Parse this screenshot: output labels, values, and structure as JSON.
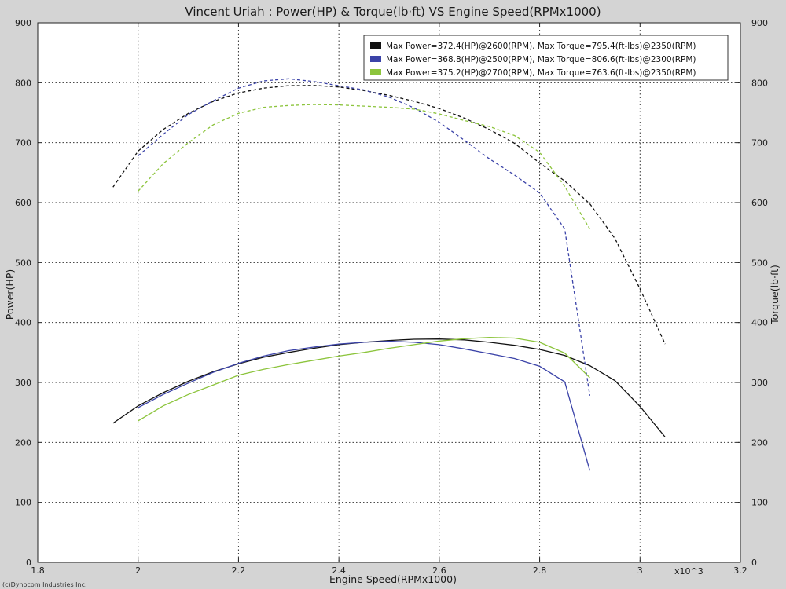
{
  "chart_data": {
    "type": "line",
    "title": "Vincent Uriah : Power(HP) & Torque(lb·ft) VS Engine Speed(RPMx1000)",
    "xlabel": "Engine Speed(RPMx1000)",
    "ylabel": "Power(HP)",
    "y2label": "Torque(lb·ft)",
    "x_multiplier": "x10^3",
    "copyright": "(c)Dynocom Industries Inc.",
    "xlim": [
      1.8,
      3.2
    ],
    "ylim": [
      0,
      900
    ],
    "y2lim": [
      0,
      900
    ],
    "x_ticks": [
      1.8,
      2,
      2.2,
      2.4,
      2.6,
      2.8,
      3,
      3.2
    ],
    "x_tick_labels": [
      "1.8",
      "2",
      "2.2",
      "2.4",
      "2.6",
      "2.8",
      "3",
      "3.2"
    ],
    "y_ticks": [
      0,
      100,
      200,
      300,
      400,
      500,
      600,
      700,
      800,
      900
    ],
    "y_tick_labels": [
      "0",
      "100",
      "200",
      "300",
      "400",
      "500",
      "600",
      "700",
      "800",
      "900"
    ],
    "grid": true,
    "legend_position": "top-right",
    "legend": [
      "Max Power=372.4(HP)@2600(RPM), Max Torque=795.4(ft-lbs)@2350(RPM)",
      "Max Power=368.8(HP)@2500(RPM), Max Torque=806.6(ft-lbs)@2300(RPM)",
      "Max Power=375.2(HP)@2700(RPM), Max Torque=763.6(ft-lbs)@2350(RPM)"
    ],
    "series": [
      {
        "color": "#111111",
        "power": {
          "x": [
            1.95,
            2.0,
            2.05,
            2.1,
            2.15,
            2.2,
            2.25,
            2.3,
            2.35,
            2.4,
            2.45,
            2.5,
            2.55,
            2.6,
            2.65,
            2.7,
            2.75,
            2.8,
            2.85,
            2.9,
            2.95,
            3.0,
            3.05
          ],
          "y": [
            232,
            261,
            283,
            302,
            318,
            331,
            342,
            350,
            357,
            363,
            367,
            370,
            372,
            372.4,
            371,
            367,
            362,
            355,
            345,
            328,
            303,
            260,
            209
          ]
        },
        "torque": {
          "x": [
            1.95,
            2.0,
            2.05,
            2.1,
            2.15,
            2.2,
            2.25,
            2.3,
            2.35,
            2.4,
            2.45,
            2.5,
            2.55,
            2.6,
            2.65,
            2.7,
            2.75,
            2.8,
            2.85,
            2.9,
            2.95,
            3.0,
            3.05
          ],
          "y": [
            626,
            686,
            722,
            749,
            769,
            783,
            791,
            795,
            795.4,
            793,
            787,
            779,
            769,
            757,
            741,
            722,
            699,
            666,
            636,
            598,
            540,
            456,
            364
          ]
        }
      },
      {
        "color": "#3b43a8",
        "power": {
          "x": [
            2.0,
            2.05,
            2.1,
            2.15,
            2.2,
            2.25,
            2.3,
            2.35,
            2.4,
            2.45,
            2.5,
            2.55,
            2.6,
            2.65,
            2.7,
            2.75,
            2.8,
            2.85,
            2.9
          ],
          "y": [
            258,
            280,
            299,
            317,
            332,
            344,
            353,
            359,
            364,
            367,
            368.8,
            367,
            363,
            356,
            348,
            340,
            327,
            301,
            153
          ]
        },
        "torque": {
          "x": [
            2.0,
            2.05,
            2.1,
            2.15,
            2.2,
            2.25,
            2.3,
            2.35,
            2.4,
            2.45,
            2.5,
            2.55,
            2.6,
            2.65,
            2.7,
            2.75,
            2.8,
            2.85,
            2.9
          ],
          "y": [
            678,
            714,
            747,
            770,
            791,
            803,
            806.6,
            802,
            795,
            788,
            776,
            758,
            734,
            704,
            673,
            646,
            616,
            556,
            278
          ]
        }
      },
      {
        "color": "#8cc43c",
        "power": {
          "x": [
            2.0,
            2.05,
            2.1,
            2.15,
            2.2,
            2.25,
            2.3,
            2.35,
            2.4,
            2.45,
            2.5,
            2.55,
            2.6,
            2.65,
            2.7,
            2.75,
            2.8,
            2.85,
            2.9
          ],
          "y": [
            236,
            261,
            280,
            296,
            312,
            322,
            330,
            337,
            344,
            350,
            357,
            363,
            369,
            373,
            375.2,
            374,
            367,
            349,
            308
          ]
        },
        "torque": {
          "x": [
            2.0,
            2.05,
            2.1,
            2.15,
            2.2,
            2.25,
            2.3,
            2.35,
            2.4,
            2.45,
            2.5,
            2.55,
            2.6,
            2.65,
            2.7,
            2.75,
            2.8,
            2.85,
            2.9
          ],
          "y": [
            619,
            665,
            700,
            730,
            749,
            759,
            762,
            763.6,
            763,
            761,
            759,
            756,
            748,
            737,
            727,
            712,
            684,
            627,
            556
          ]
        }
      }
    ]
  }
}
